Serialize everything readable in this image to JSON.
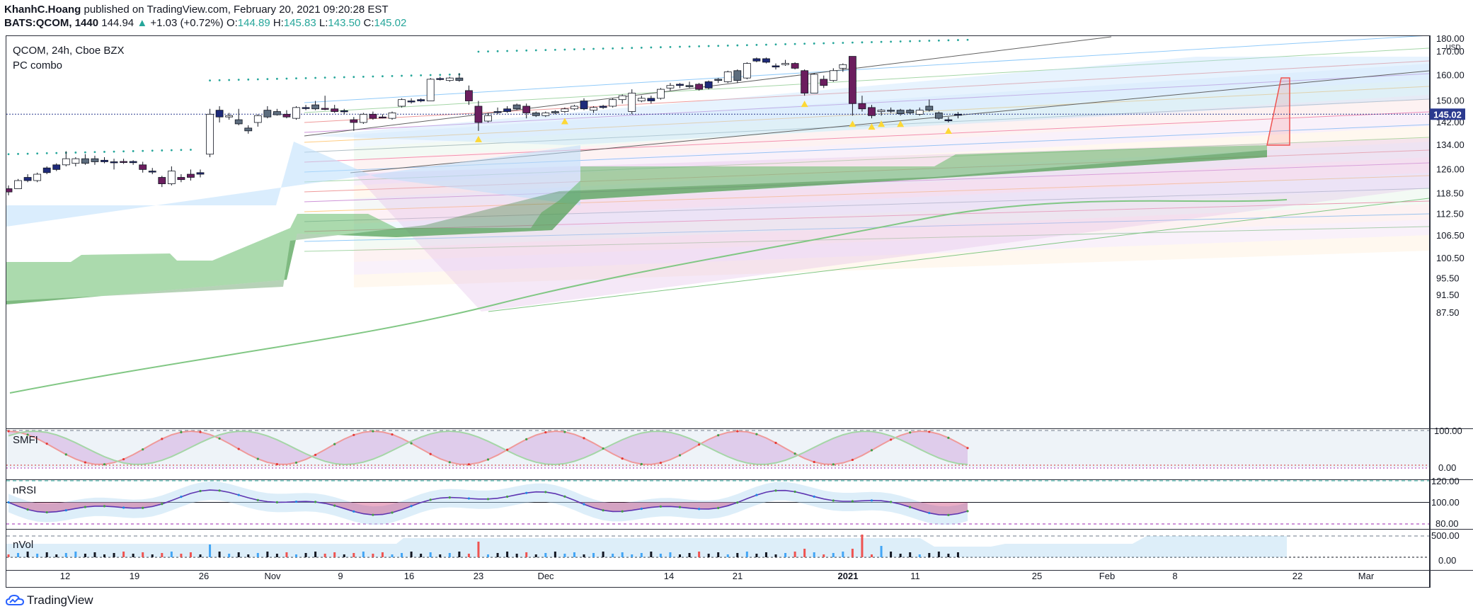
{
  "header": {
    "author": "KhanhC.Hoang",
    "published_text": "published on TradingView.com, February 20, 2021 09:20:28 EST",
    "symbol_line": "BATS:QCOM, 1440",
    "last": "144.94",
    "change_arrow": "▲",
    "change": "+1.03 (+0.72%)",
    "o_label": "O:",
    "o_value": "144.89",
    "h_label": "H:",
    "h_value": "145.83",
    "l_label": "L:",
    "l_value": "143.50",
    "c_label": "C:",
    "c_value": "145.02"
  },
  "main_pane": {
    "title": "QCOM, 24h, Cboe BZX",
    "indicator": "PC combo",
    "currency": "USD",
    "price_badge": "145.02"
  },
  "sub_panes": [
    {
      "label": "SMFI",
      "ticks": [
        "100.00",
        "0.00"
      ]
    },
    {
      "label": "nRSI",
      "ticks": [
        "120.00",
        "100.00",
        "80.00"
      ]
    },
    {
      "label": "nVol",
      "ticks": [
        "500.00",
        "0.00"
      ]
    }
  ],
  "footer": {
    "brand": "TradingView"
  },
  "colors": {
    "up": "#ffffff",
    "down": "#6b1d5e",
    "neutral_up": "#1e2a7a",
    "grey_bar": "#5d6d7e",
    "ema": "#4caf50",
    "badge": "#2b3a8f"
  },
  "chart_data": {
    "type": "candlestick",
    "y_scale": "log",
    "y_ticks": [
      "180.00",
      "170.00",
      "160.00",
      "150.00",
      "145.02",
      "142.00",
      "134.00",
      "126.00",
      "118.50",
      "112.50",
      "106.50",
      "100.50",
      "95.50",
      "91.50",
      "87.50"
    ],
    "x_ticks": [
      "12",
      "19",
      "26",
      "Nov",
      "9",
      "16",
      "23",
      "Dec",
      "14",
      "21",
      "2021",
      "11",
      "25",
      "Feb",
      "8",
      "22",
      "Mar"
    ],
    "candles": [
      {
        "o": 119,
        "h": 121,
        "l": 118,
        "c": 120,
        "t": "down"
      },
      {
        "o": 120,
        "h": 123,
        "l": 120,
        "c": 122.5,
        "t": "up"
      },
      {
        "o": 122.5,
        "h": 124.5,
        "l": 122,
        "c": 123.5,
        "t": "nu"
      },
      {
        "o": 122.5,
        "h": 125,
        "l": 122,
        "c": 124.5,
        "t": "up"
      },
      {
        "o": 125,
        "h": 127,
        "l": 124.5,
        "c": 126.5,
        "t": "nu"
      },
      {
        "o": 126,
        "h": 128,
        "l": 125.5,
        "c": 127.5,
        "t": "nu"
      },
      {
        "o": 127.5,
        "h": 132,
        "l": 127,
        "c": 129.5,
        "t": "up"
      },
      {
        "o": 129.5,
        "h": 130,
        "l": 127,
        "c": 128,
        "t": "up"
      },
      {
        "o": 128,
        "h": 131,
        "l": 127.5,
        "c": 129.5,
        "t": "gr"
      },
      {
        "o": 129.5,
        "h": 130.5,
        "l": 127.5,
        "c": 128.5,
        "t": "gr"
      },
      {
        "o": 129,
        "h": 130,
        "l": 128,
        "c": 128.5,
        "t": "nu"
      },
      {
        "o": 128.5,
        "h": 129.5,
        "l": 126,
        "c": 128.3,
        "t": "nu"
      },
      {
        "o": 128.3,
        "h": 129.5,
        "l": 127.8,
        "c": 128.6,
        "t": "down"
      },
      {
        "o": 128.6,
        "h": 129,
        "l": 127.5,
        "c": 128.2,
        "t": "nu"
      },
      {
        "o": 127.5,
        "h": 128.5,
        "l": 125,
        "c": 126,
        "t": "down"
      },
      {
        "o": 125.5,
        "h": 126.5,
        "l": 124.5,
        "c": 125.5,
        "t": "nu"
      },
      {
        "o": 123.5,
        "h": 124,
        "l": 120.5,
        "c": 121.5,
        "t": "down"
      },
      {
        "o": 121.5,
        "h": 127,
        "l": 121,
        "c": 125.5,
        "t": "up"
      },
      {
        "o": 123.5,
        "h": 124.5,
        "l": 122,
        "c": 122.8,
        "t": "down"
      },
      {
        "o": 124.5,
        "h": 126,
        "l": 122.5,
        "c": 123.5,
        "t": "down"
      },
      {
        "o": 124.5,
        "h": 126,
        "l": 123.5,
        "c": 125,
        "t": "nu"
      },
      {
        "o": 131,
        "h": 147,
        "l": 130,
        "c": 145,
        "t": "up"
      },
      {
        "o": 146.5,
        "h": 148,
        "l": 142,
        "c": 144,
        "t": "nu"
      },
      {
        "o": 144,
        "h": 145.5,
        "l": 143,
        "c": 144.5,
        "t": "up"
      },
      {
        "o": 143,
        "h": 147,
        "l": 141,
        "c": 141.5,
        "t": "gr"
      },
      {
        "o": 140,
        "h": 141,
        "l": 138,
        "c": 139,
        "t": "gr"
      },
      {
        "o": 142,
        "h": 145,
        "l": 140.5,
        "c": 144.5,
        "t": "up"
      },
      {
        "o": 146.5,
        "h": 148,
        "l": 143.5,
        "c": 144,
        "t": "gr"
      },
      {
        "o": 146,
        "h": 147,
        "l": 144.5,
        "c": 144.8,
        "t": "gr"
      },
      {
        "o": 145,
        "h": 146.5,
        "l": 143.5,
        "c": 144,
        "t": "down"
      },
      {
        "o": 143.5,
        "h": 148,
        "l": 143,
        "c": 147.5,
        "t": "up"
      },
      {
        "o": 147.5,
        "h": 148.5,
        "l": 146.5,
        "c": 147.2,
        "t": "nu"
      },
      {
        "o": 148.5,
        "h": 150,
        "l": 146.5,
        "c": 147,
        "t": "gr"
      },
      {
        "o": 147,
        "h": 152,
        "l": 146.5,
        "c": 147.2,
        "t": "down"
      },
      {
        "o": 147,
        "h": 148.5,
        "l": 145.5,
        "c": 146,
        "t": "down"
      },
      {
        "o": 146,
        "h": 147,
        "l": 145,
        "c": 146.3,
        "t": "nu"
      },
      {
        "o": 143,
        "h": 144,
        "l": 139,
        "c": 142,
        "t": "down"
      },
      {
        "o": 142,
        "h": 145.5,
        "l": 141.5,
        "c": 145,
        "t": "up"
      },
      {
        "o": 145,
        "h": 146,
        "l": 143,
        "c": 143.5,
        "t": "down"
      },
      {
        "o": 144,
        "h": 145,
        "l": 143.5,
        "c": 144,
        "t": "down"
      },
      {
        "o": 143.5,
        "h": 146,
        "l": 143,
        "c": 145.5,
        "t": "up"
      },
      {
        "o": 148,
        "h": 151,
        "l": 147.5,
        "c": 150.5,
        "t": "up"
      },
      {
        "o": 150,
        "h": 151,
        "l": 149,
        "c": 150,
        "t": "nu"
      },
      {
        "o": 150,
        "h": 151,
        "l": 149.5,
        "c": 150.5,
        "t": "nu"
      },
      {
        "o": 150,
        "h": 159,
        "l": 150,
        "c": 158.5,
        "t": "up"
      },
      {
        "o": 158.5,
        "h": 159.5,
        "l": 158,
        "c": 158.8,
        "t": "nu"
      },
      {
        "o": 158,
        "h": 159.5,
        "l": 157.5,
        "c": 159,
        "t": "up"
      },
      {
        "o": 159,
        "h": 161,
        "l": 157.5,
        "c": 158,
        "t": "gr"
      },
      {
        "o": 154,
        "h": 156,
        "l": 148.5,
        "c": 150,
        "t": "down"
      },
      {
        "o": 148,
        "h": 150,
        "l": 139,
        "c": 142,
        "t": "down"
      },
      {
        "o": 142.5,
        "h": 145.5,
        "l": 142,
        "c": 144.5,
        "t": "up"
      },
      {
        "o": 146,
        "h": 147.5,
        "l": 145,
        "c": 146,
        "t": "nu"
      },
      {
        "o": 146,
        "h": 148,
        "l": 145.5,
        "c": 147,
        "t": "nu"
      },
      {
        "o": 147,
        "h": 149,
        "l": 146.5,
        "c": 148.5,
        "t": "gr"
      },
      {
        "o": 148,
        "h": 149,
        "l": 143.5,
        "c": 145.5,
        "t": "down"
      },
      {
        "o": 145.5,
        "h": 146,
        "l": 144,
        "c": 144.5,
        "t": "gr"
      },
      {
        "o": 144.5,
        "h": 146,
        "l": 144,
        "c": 145.5,
        "t": "up"
      },
      {
        "o": 145.5,
        "h": 146.5,
        "l": 145,
        "c": 146,
        "t": "gr"
      },
      {
        "o": 146,
        "h": 147.5,
        "l": 145.5,
        "c": 147,
        "t": "up"
      },
      {
        "o": 147,
        "h": 148.5,
        "l": 146.5,
        "c": 148,
        "t": "up"
      },
      {
        "o": 150,
        "h": 151,
        "l": 146.5,
        "c": 147,
        "t": "nu"
      },
      {
        "o": 146.5,
        "h": 148,
        "l": 145.5,
        "c": 147.5,
        "t": "up"
      },
      {
        "o": 147.5,
        "h": 148.5,
        "l": 147,
        "c": 148,
        "t": "nu"
      },
      {
        "o": 148,
        "h": 151,
        "l": 147.5,
        "c": 150.5,
        "t": "up"
      },
      {
        "o": 150.5,
        "h": 152.5,
        "l": 149,
        "c": 152,
        "t": "up"
      },
      {
        "o": 146,
        "h": 154.5,
        "l": 145,
        "c": 153,
        "t": "up"
      },
      {
        "o": 150,
        "h": 152,
        "l": 149.5,
        "c": 151,
        "t": "up"
      },
      {
        "o": 151,
        "h": 152,
        "l": 149,
        "c": 150,
        "t": "nu"
      },
      {
        "o": 151,
        "h": 155,
        "l": 150.5,
        "c": 154.5,
        "t": "up"
      },
      {
        "o": 155,
        "h": 157,
        "l": 154,
        "c": 156,
        "t": "up"
      },
      {
        "o": 156,
        "h": 157,
        "l": 155,
        "c": 156.5,
        "t": "nu"
      },
      {
        "o": 156,
        "h": 157.5,
        "l": 155,
        "c": 155.5,
        "t": "gr"
      },
      {
        "o": 154.5,
        "h": 157,
        "l": 154,
        "c": 156.5,
        "t": "down"
      },
      {
        "o": 155,
        "h": 158,
        "l": 154.5,
        "c": 157.5,
        "t": "nu"
      },
      {
        "o": 158,
        "h": 159,
        "l": 157,
        "c": 158.5,
        "t": "gr"
      },
      {
        "o": 157.5,
        "h": 162,
        "l": 157,
        "c": 161.5,
        "t": "up"
      },
      {
        "o": 162,
        "h": 162.5,
        "l": 157,
        "c": 158,
        "t": "gr"
      },
      {
        "o": 159,
        "h": 165.5,
        "l": 158.5,
        "c": 165,
        "t": "up"
      },
      {
        "o": 166,
        "h": 167.5,
        "l": 165.5,
        "c": 167,
        "t": "nu"
      },
      {
        "o": 167,
        "h": 167.5,
        "l": 165,
        "c": 165.5,
        "t": "nu"
      },
      {
        "o": 164,
        "h": 165,
        "l": 162.5,
        "c": 163.5,
        "t": "nu"
      },
      {
        "o": 164.5,
        "h": 166.5,
        "l": 164,
        "c": 165,
        "t": "up"
      },
      {
        "o": 165,
        "h": 165.5,
        "l": 162.5,
        "c": 163,
        "t": "down"
      },
      {
        "o": 162,
        "h": 162.5,
        "l": 152,
        "c": 153,
        "t": "down"
      },
      {
        "o": 153,
        "h": 161,
        "l": 153,
        "c": 160.5,
        "t": "up"
      },
      {
        "o": 158.5,
        "h": 160,
        "l": 155,
        "c": 156,
        "t": "down"
      },
      {
        "o": 158,
        "h": 163,
        "l": 157.5,
        "c": 162,
        "t": "up"
      },
      {
        "o": 163,
        "h": 165,
        "l": 161.5,
        "c": 164.5,
        "t": "up"
      },
      {
        "o": 168,
        "h": 168,
        "l": 144.5,
        "c": 149,
        "t": "down"
      },
      {
        "o": 149,
        "h": 152,
        "l": 146,
        "c": 147,
        "t": "down"
      },
      {
        "o": 147.5,
        "h": 148.5,
        "l": 143.5,
        "c": 144.5,
        "t": "down"
      },
      {
        "o": 146.5,
        "h": 147,
        "l": 144.5,
        "c": 146,
        "t": "up"
      },
      {
        "o": 146.5,
        "h": 147.5,
        "l": 145.5,
        "c": 146.5,
        "t": "gr"
      },
      {
        "o": 146.5,
        "h": 147,
        "l": 144.5,
        "c": 145.2,
        "t": "gr"
      },
      {
        "o": 146.5,
        "h": 147,
        "l": 145,
        "c": 145.5,
        "t": "gr"
      },
      {
        "o": 145,
        "h": 147.5,
        "l": 144.5,
        "c": 146.5,
        "t": "up"
      },
      {
        "o": 148,
        "h": 150.5,
        "l": 146,
        "c": 146.5,
        "t": "gr"
      },
      {
        "o": 145.5,
        "h": 146,
        "l": 143,
        "c": 143.5,
        "t": "gr"
      },
      {
        "o": 143,
        "h": 144,
        "l": 142,
        "c": 143,
        "t": "nu"
      },
      {
        "o": 144.89,
        "h": 145.83,
        "l": 143.5,
        "c": 145.02,
        "t": "nu"
      }
    ]
  }
}
